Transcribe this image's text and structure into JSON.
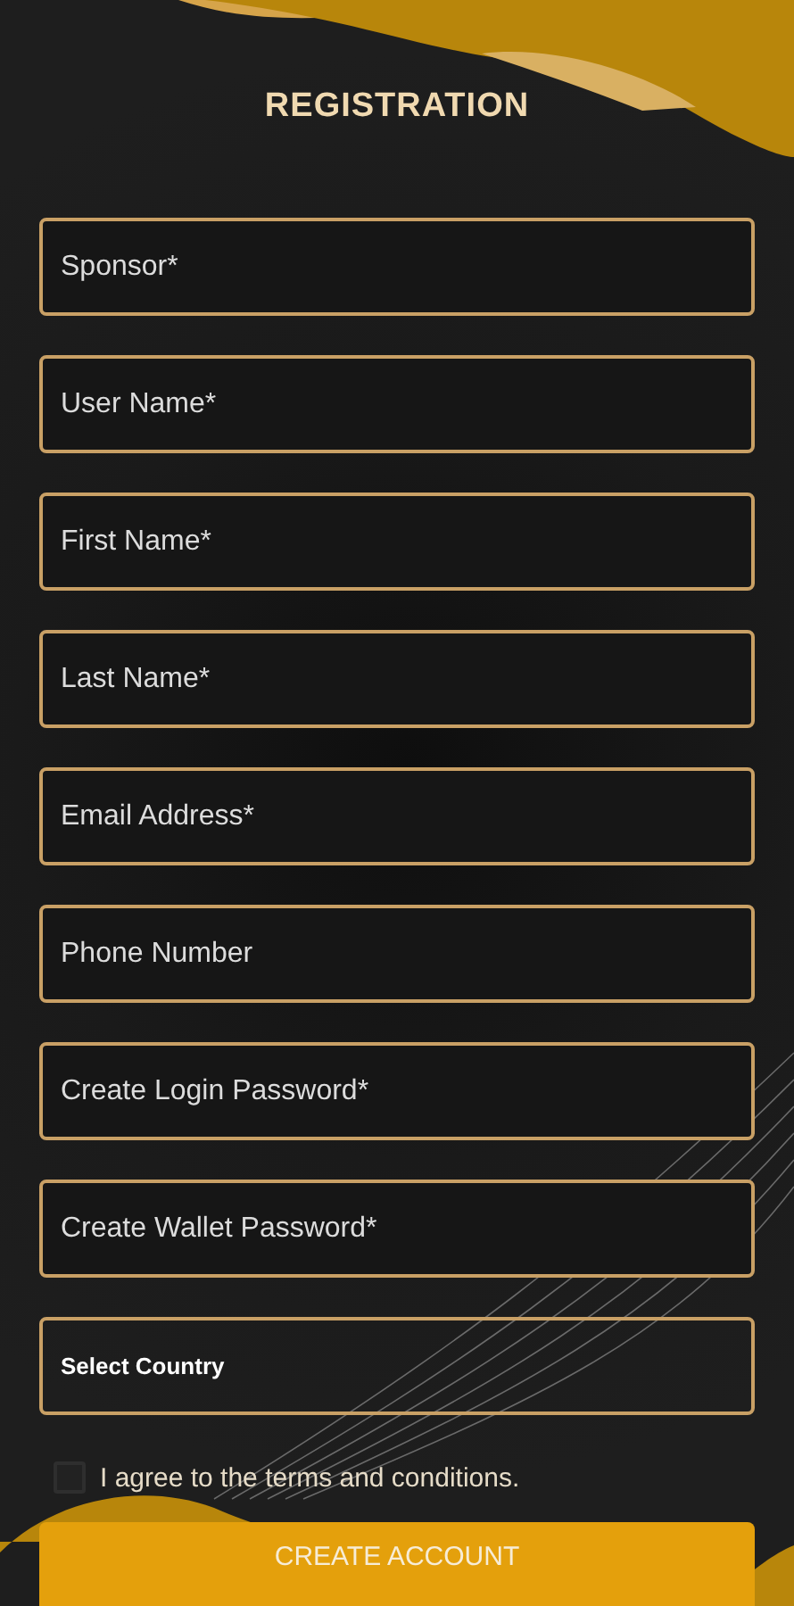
{
  "title": "REGISTRATION",
  "fields": [
    {
      "kind": "text",
      "placeholder": "Sponsor*"
    },
    {
      "kind": "text",
      "placeholder": "User Name*"
    },
    {
      "kind": "text",
      "placeholder": "First Name*"
    },
    {
      "kind": "text",
      "placeholder": "Last Name*"
    },
    {
      "kind": "text",
      "placeholder": "Email Address*"
    },
    {
      "kind": "text",
      "placeholder": "Phone Number"
    },
    {
      "kind": "text",
      "placeholder": "Create Login Password*"
    },
    {
      "kind": "text",
      "placeholder": "Create Wallet Password*"
    },
    {
      "kind": "select",
      "placeholder": "Select Country"
    }
  ],
  "agree": {
    "label": "I agree to the terms and conditions.",
    "checked": false
  },
  "button": "CREATE ACCOUNT"
}
